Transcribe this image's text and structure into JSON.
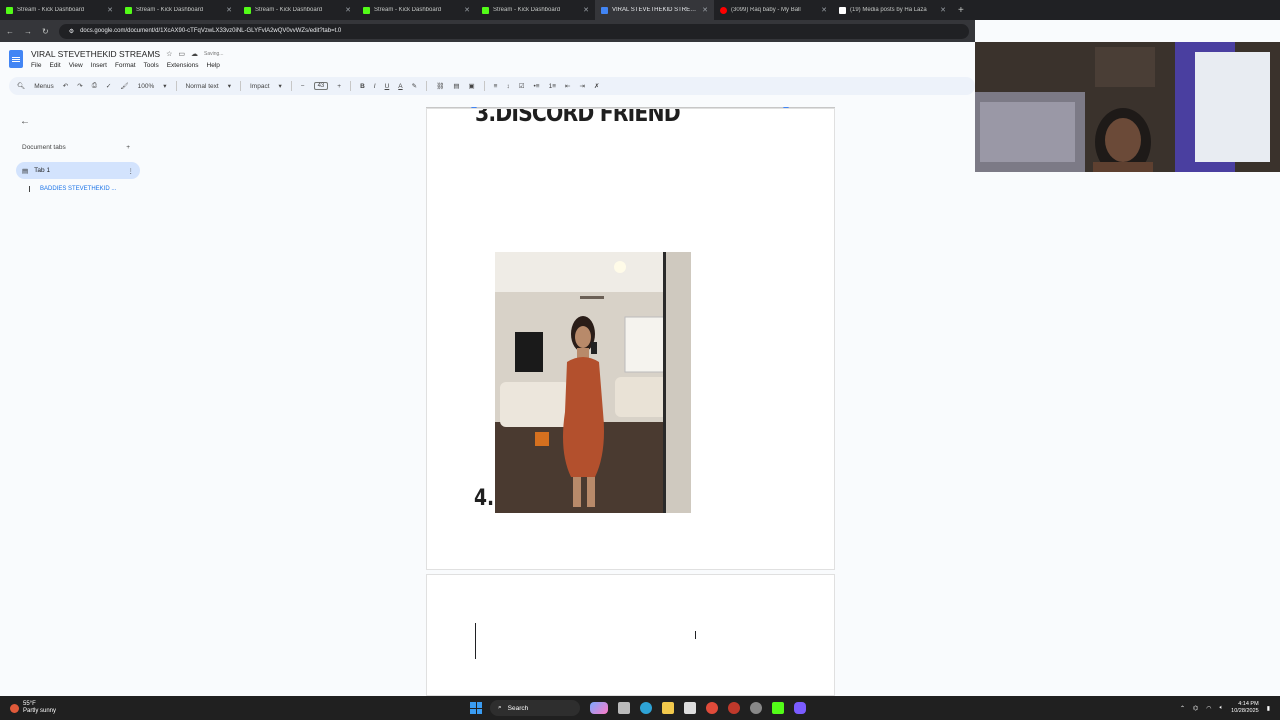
{
  "browser": {
    "tabs": [
      {
        "title": "Stream - Kick Dashboard",
        "icon": "kick-icon"
      },
      {
        "title": "Stream - Kick Dashboard",
        "icon": "kick-icon"
      },
      {
        "title": "Stream - Kick Dashboard",
        "icon": "kick-icon"
      },
      {
        "title": "Stream - Kick Dashboard",
        "icon": "kick-icon"
      },
      {
        "title": "Stream - Kick Dashboard",
        "icon": "kick-icon"
      },
      {
        "title": "VIRAL STEVETHEKID STREAMS",
        "icon": "google-docs-icon",
        "active": true
      },
      {
        "title": "(3099) Raq baby - My Ball",
        "icon": "youtube-icon"
      },
      {
        "title": "(19) Media posts by Ha Laza",
        "icon": "x-icon"
      }
    ],
    "url": "docs.google.com/document/d/1XcAX90-cTFqVzwLX33vz0iNL-GLYFvlA2wQV0vvWZs/edit?tab=t.0"
  },
  "doc": {
    "title": "VIRAL STEVETHEKID STREAMS",
    "status": "Saving...",
    "menus": [
      "File",
      "Edit",
      "View",
      "Insert",
      "Format",
      "Tools",
      "Extensions",
      "Help"
    ]
  },
  "toolbar": {
    "menus_label": "Menus",
    "zoom": "100%",
    "style": "Normal text",
    "font": "Impact",
    "font_size": "43"
  },
  "sidebar": {
    "doc_tabs_label": "Document tabs",
    "add_label": "+",
    "tab_label": "Tab 1",
    "outline_item": "BADDIES STEVETHEKID ..."
  },
  "page": {
    "heading3": "3.DISCORD FRIEND",
    "number4": "4."
  },
  "taskbar": {
    "temp": "55°F",
    "weather": "Partly sunny",
    "search_label": "Search",
    "time": "4:14 PM",
    "date": "10/28/2025"
  },
  "colors": {
    "kick": "#53fc18",
    "docs": "#4285f4",
    "youtube": "#ff0000",
    "selected_tab": "#d3e3fd"
  }
}
